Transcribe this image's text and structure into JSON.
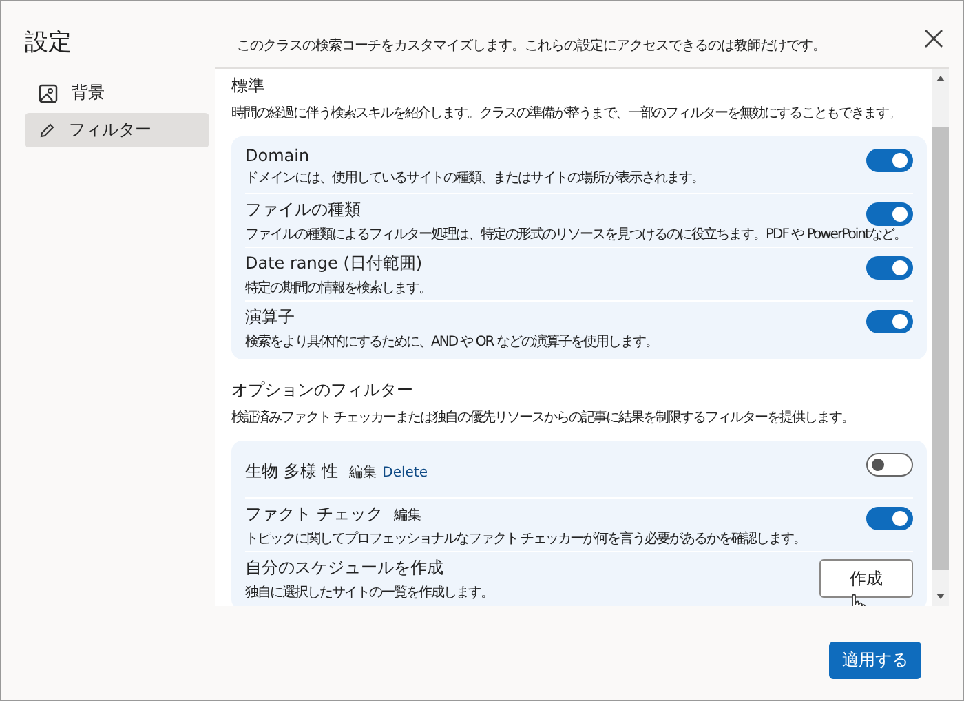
{
  "sidebar": {
    "title": "設定",
    "items": [
      {
        "label": "背景",
        "selected": false
      },
      {
        "label": "フィルター",
        "selected": true
      }
    ]
  },
  "header": {
    "text": "このクラスの検索コーチをカスタマイズします。これらの設定にアクセスできるのは教師だけです。"
  },
  "sections": [
    {
      "title": "標準",
      "description": "時間の経過に伴う検索スキルを紹介します。クラスの準備が整うまで、一部のフィルターを無効にすることもできます。",
      "items": [
        {
          "kind": "toggle",
          "title": "Domain",
          "description": "ドメインには、使用しているサイトの種類、またはサイトの場所が表示されます。",
          "on": true
        },
        {
          "kind": "toggle",
          "title": "ファイルの種類",
          "description": "ファイルの種類によるフィルター処理は、特定の形式のリソースを見つけるのに役立ちます。PDF や PowerPointなど。",
          "on": true
        },
        {
          "kind": "toggle",
          "title": "Date range (日付範囲)",
          "description": "特定の期間の情報を検索します。",
          "on": true
        },
        {
          "kind": "toggle",
          "title": "演算子",
          "description": "検索をより具体的にするために、AND や OR などの演算子を使用します。",
          "on": true
        }
      ]
    },
    {
      "title": "オプションのフィルター",
      "description": "検証済みファクト チェッカーまたは独自の優先リソースからの記事に結果を制限するフィルターを提供します。",
      "items": [
        {
          "kind": "toggle",
          "title": "生物 多様 性",
          "edit": "編集",
          "delete": "Delete",
          "on": false
        },
        {
          "kind": "toggle",
          "title": "ファクト チェック",
          "edit": "編集",
          "description": "トピックに関してプロフェッショナルなファクト チェッカーが何を言う必要があるかを確認します。",
          "on": true
        },
        {
          "kind": "button",
          "title": "自分のスケジュールを作成",
          "description": "独自に選択したサイトの一覧を作成します。",
          "button": "作成"
        }
      ]
    }
  ],
  "apply_button": "適用する"
}
